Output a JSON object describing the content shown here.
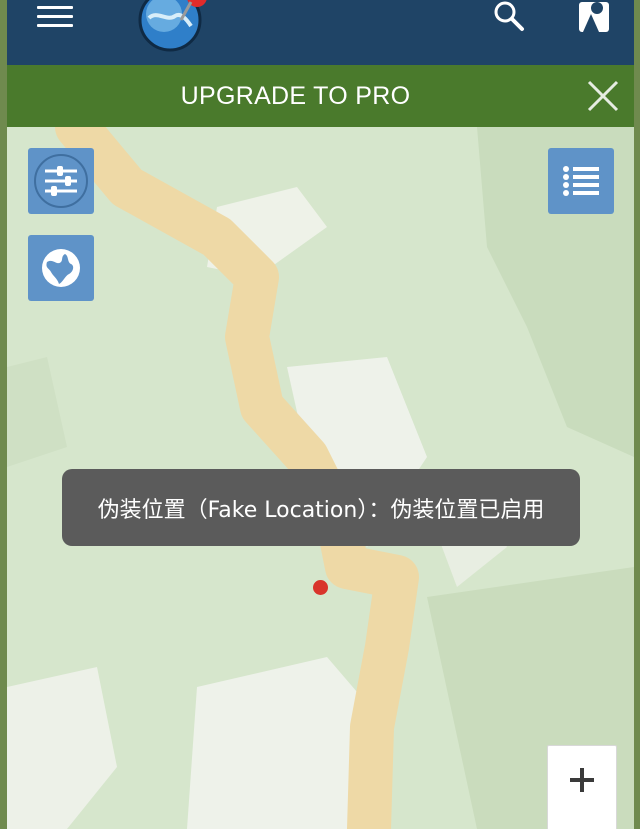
{
  "topbar": {
    "icons": [
      "menu-icon",
      "globe-pin-logo",
      "search-icon",
      "user-icon"
    ],
    "background": "#1f4466"
  },
  "promo": {
    "text": "UPGRADE TO PRO",
    "close_icon": "close-icon",
    "background": "#4a7a2c"
  },
  "map": {
    "controls": [
      "filter-sliders-icon",
      "globe-icon",
      "list-icon",
      "zoom-in-icon"
    ],
    "accent": "#5f93c8",
    "location_dot_color": "#d9342b"
  },
  "toast": {
    "message": "伪装位置（Fake Location）：伪装位置已启用"
  }
}
